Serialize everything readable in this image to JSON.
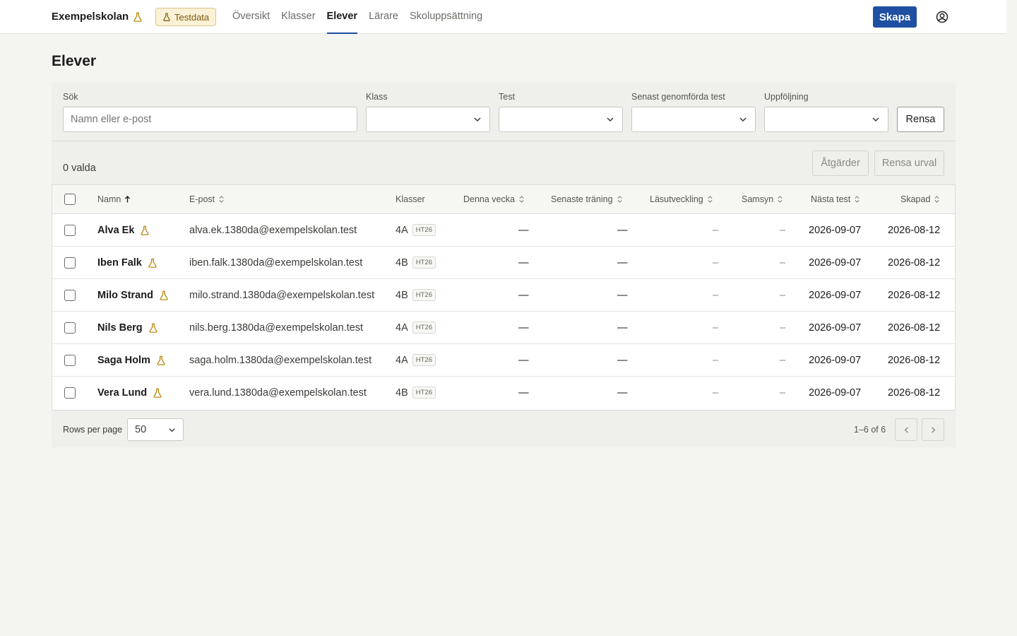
{
  "header": {
    "brand": "Exempelskolan",
    "test_badge": "Testdata",
    "nav": [
      {
        "label": "Översikt",
        "active": false
      },
      {
        "label": "Klasser",
        "active": false
      },
      {
        "label": "Elever",
        "active": true
      },
      {
        "label": "Lärare",
        "active": false
      },
      {
        "label": "Skoluppsättning",
        "active": false
      }
    ],
    "create_label": "Skapa"
  },
  "page": {
    "title": "Elever"
  },
  "filters": {
    "search_label": "Sök",
    "search_placeholder": "Namn eller e-post",
    "class_label": "Klass",
    "test_label": "Test",
    "latest_label": "Senast genomförda test",
    "followup_label": "Uppföljning",
    "clear_label": "Rensa"
  },
  "selection": {
    "count": "0 valda",
    "actions_label": "Åtgärder",
    "clear_selection_label": "Rensa urval"
  },
  "table": {
    "columns": {
      "name": "Namn",
      "email": "E-post",
      "classes": "Klasser",
      "this_week": "Denna vecka",
      "latest_training": "Senaste träning",
      "reading": "Läsutveckling",
      "samsyn": "Samsyn",
      "next_test": "Nästa test",
      "created": "Skapad"
    },
    "rows": [
      {
        "name": "Alva Ek",
        "email": "alva.ek.1380da@exempelskolan.test",
        "class": "4A",
        "term": "HT26",
        "this_week": "—",
        "latest_training": "—",
        "reading": "–",
        "samsyn": "–",
        "next_test": "2026-09-07",
        "created": "2026-08-12"
      },
      {
        "name": "Iben Falk",
        "email": "iben.falk.1380da@exempelskolan.test",
        "class": "4B",
        "term": "HT26",
        "this_week": "—",
        "latest_training": "—",
        "reading": "–",
        "samsyn": "–",
        "next_test": "2026-09-07",
        "created": "2026-08-12"
      },
      {
        "name": "Milo Strand",
        "email": "milo.strand.1380da@exempelskolan.test",
        "class": "4B",
        "term": "HT26",
        "this_week": "—",
        "latest_training": "—",
        "reading": "–",
        "samsyn": "–",
        "next_test": "2026-09-07",
        "created": "2026-08-12"
      },
      {
        "name": "Nils Berg",
        "email": "nils.berg.1380da@exempelskolan.test",
        "class": "4A",
        "term": "HT26",
        "this_week": "—",
        "latest_training": "—",
        "reading": "–",
        "samsyn": "–",
        "next_test": "2026-09-07",
        "created": "2026-08-12"
      },
      {
        "name": "Saga Holm",
        "email": "saga.holm.1380da@exempelskolan.test",
        "class": "4A",
        "term": "HT26",
        "this_week": "—",
        "latest_training": "—",
        "reading": "–",
        "samsyn": "–",
        "next_test": "2026-09-07",
        "created": "2026-08-12"
      },
      {
        "name": "Vera Lund",
        "email": "vera.lund.1380da@exempelskolan.test",
        "class": "4B",
        "term": "HT26",
        "this_week": "—",
        "latest_training": "—",
        "reading": "–",
        "samsyn": "–",
        "next_test": "2026-09-07",
        "created": "2026-08-12"
      }
    ]
  },
  "pagination": {
    "rows_per_page_label": "Rows per page",
    "rows_per_page": "50",
    "range": "1–6 of 6"
  },
  "colors": {
    "accent": "#1f4fa3",
    "test_badge_bg": "#faf1d6",
    "flask": "#b8860b"
  }
}
